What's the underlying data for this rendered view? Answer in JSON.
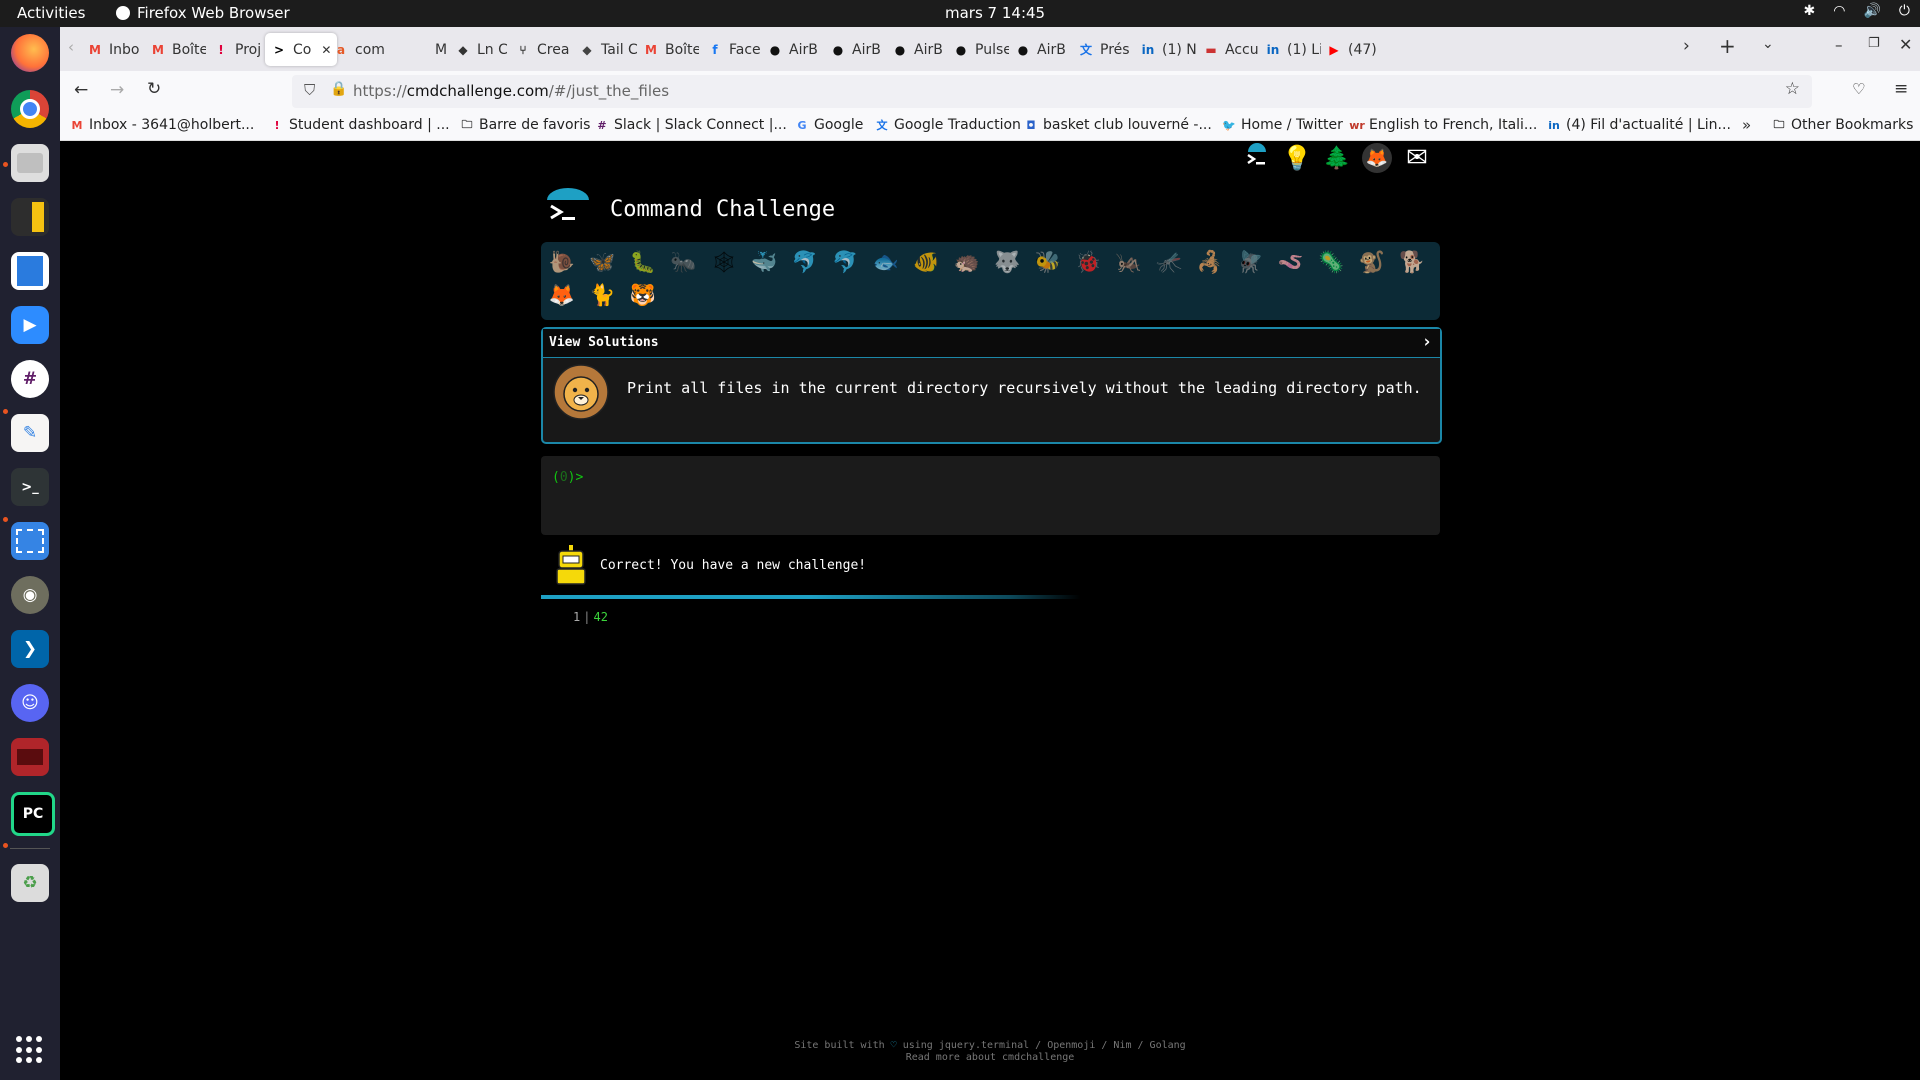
{
  "topbar": {
    "activities": "Activities",
    "app_name": "Firefox Web Browser",
    "clock": "mars 7  14:45"
  },
  "browser": {
    "tabs": [
      {
        "label": "Inbo",
        "icon": "gmail-icon"
      },
      {
        "label": "Boîte",
        "icon": "gmail-icon"
      },
      {
        "label": "Proje",
        "icon": "holberton-icon"
      },
      {
        "label": "Co",
        "icon": "terminal-icon"
      },
      {
        "label": "com",
        "icon": "ask-icon"
      },
      {
        "label": "My s",
        "icon": "blank-icon"
      },
      {
        "label": "Ln C",
        "icon": "ln-icon"
      },
      {
        "label": "Crea",
        "icon": "git-icon"
      },
      {
        "label": "Tail C",
        "icon": "tail-icon"
      },
      {
        "label": "Boîte",
        "icon": "gmail-icon"
      },
      {
        "label": "Facel",
        "icon": "facebook-icon"
      },
      {
        "label": "AirB",
        "icon": "github-icon"
      },
      {
        "label": "AirB",
        "icon": "github-icon"
      },
      {
        "label": "AirB",
        "icon": "github-icon"
      },
      {
        "label": "Pulse",
        "icon": "github-icon"
      },
      {
        "label": "AirB",
        "icon": "github-icon"
      },
      {
        "label": "Prés",
        "icon": "translate-icon"
      },
      {
        "label": "(1) N",
        "icon": "linkedin-icon"
      },
      {
        "label": "Accu",
        "icon": "accu-icon"
      },
      {
        "label": "(1) Li",
        "icon": "linkedin-icon"
      },
      {
        "label": "(47)",
        "icon": "youtube-icon"
      }
    ],
    "url_prefix": "https://",
    "url_domain": "cmdchallenge.com",
    "url_path": "/#/just_the_files",
    "bookmarks": [
      {
        "label": "Inbox - 3641@holbert...",
        "icon": "gmail-icon"
      },
      {
        "label": "Student dashboard | ...",
        "icon": "holberton-icon"
      },
      {
        "label": "Barre de favoris",
        "icon": "folder-icon"
      },
      {
        "label": "Slack | Slack Connect |...",
        "icon": "slack-icon"
      },
      {
        "label": "Google",
        "icon": "google-icon"
      },
      {
        "label": "Google Traduction",
        "icon": "translate-icon"
      },
      {
        "label": "basket club louverné -...",
        "icon": "basket-icon"
      },
      {
        "label": "Home / Twitter",
        "icon": "twitter-icon"
      },
      {
        "label": "English to French, Itali...",
        "icon": "wr-icon"
      },
      {
        "label": "(4) Fil d'actualité | Lin...",
        "icon": "linkedin-icon"
      }
    ],
    "other_bookmarks": "Other Bookmarks"
  },
  "page": {
    "site_title": "Command Challenge",
    "view_solutions": "View Solutions",
    "challenge_text": "Print all files in the current directory recursively without the leading directory path.",
    "prompt_open": "(",
    "prompt_count": "0",
    "prompt_close": ")>",
    "result_text": "Correct! You have a new challenge!",
    "score_current": "1",
    "score_sep": "|",
    "score_total": "42",
    "footer_line1_a": "Site built with ",
    "footer_heart": "♡",
    "footer_line1_b": " using jquery.terminal / Openmoji / Nim / Golang",
    "footer_line2": "Read more about cmdchallenge"
  },
  "emojis": [
    "🐌",
    "🦋",
    "🐛",
    "🐜",
    "🕸",
    "🐳",
    "🐬",
    "🐬",
    "🐟",
    "🐠",
    "🦔",
    "🐺",
    "🐝",
    "🐞",
    "🦗",
    "🦟",
    "🦂",
    "🪰",
    "🪱",
    "🦠",
    "🐒",
    "🐕",
    "🦊",
    "🐈",
    "🐯"
  ]
}
